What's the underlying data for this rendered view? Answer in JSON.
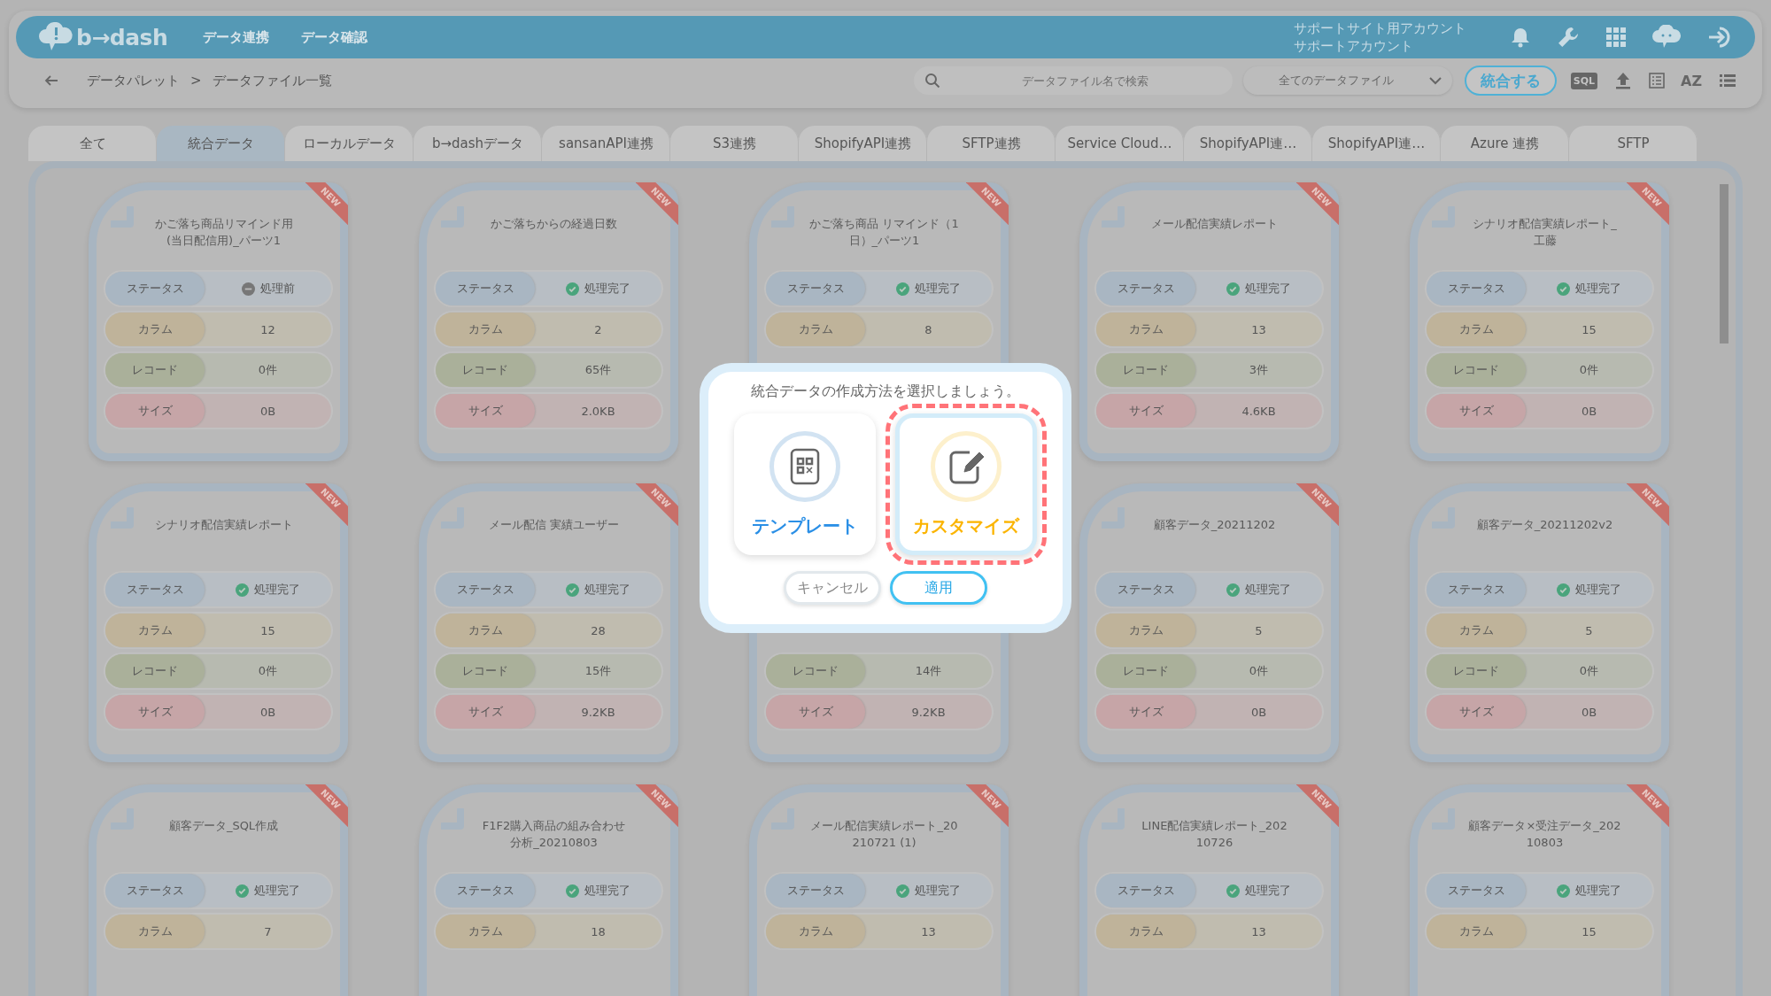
{
  "header": {
    "logo": "b→dash",
    "nav": [
      {
        "label": "データ連携"
      },
      {
        "label": "データ確認"
      }
    ],
    "account": [
      "サポートサイト用アカウント",
      "サポートアカウント"
    ]
  },
  "toolbar": {
    "breadcrumb": [
      "データパレット",
      "データファイル一覧"
    ],
    "separator": ">",
    "search": {
      "placeholder": "データファイル名で検索"
    },
    "filter": "全てのデータファイル",
    "merge_button": "統合する",
    "sql_label": "SQL",
    "sort_label": "AZ"
  },
  "tabs": [
    {
      "label": "全て",
      "selected": false
    },
    {
      "label": "統合データ",
      "selected": true
    },
    {
      "label": "ローカルデータ",
      "selected": false
    },
    {
      "label": "b→dashデータ",
      "selected": false
    },
    {
      "label": "sansanAPI連携",
      "selected": false
    },
    {
      "label": "S3連携",
      "selected": false
    },
    {
      "label": "ShopifyAPI連携",
      "selected": false
    },
    {
      "label": "SFTP連携",
      "selected": false
    },
    {
      "label": "Service Cloud…",
      "selected": false
    },
    {
      "label": "ShopifyAPI連…",
      "selected": false
    },
    {
      "label": "ShopifyAPI連…",
      "selected": false
    },
    {
      "label": "Azure 連携",
      "selected": false
    },
    {
      "label": "SFTP",
      "selected": false
    }
  ],
  "cards": [
    {
      "title": [
        "かご落ち商品リマインド用",
        "(当日配信用)_パーツ1"
      ],
      "badge": "NEW",
      "fields": [
        {
          "kind": "status",
          "label": "ステータス",
          "value": "処理前",
          "done": false
        },
        {
          "kind": "column",
          "label": "カラム",
          "value": "12"
        },
        {
          "kind": "record",
          "label": "レコード",
          "value": "0件"
        },
        {
          "kind": "size",
          "label": "サイズ",
          "value": "0B"
        }
      ]
    },
    {
      "title": [
        "かご落ちからの経過日数"
      ],
      "badge": "NEW",
      "fields": [
        {
          "kind": "status",
          "label": "ステータス",
          "value": "処理完了",
          "done": true
        },
        {
          "kind": "column",
          "label": "カラム",
          "value": "2"
        },
        {
          "kind": "record",
          "label": "レコード",
          "value": "65件"
        },
        {
          "kind": "size",
          "label": "サイズ",
          "value": "2.0KB"
        }
      ]
    },
    {
      "title": [
        "かご落ち商品 リマインド（1",
        "日）_パーツ1"
      ],
      "badge": "NEW",
      "fields": [
        {
          "kind": "status",
          "label": "ステータス",
          "value": "処理完了",
          "done": true
        },
        {
          "kind": "column",
          "label": "カラム",
          "value": "8"
        }
      ]
    },
    {
      "title": [
        "メール配信実績レポート"
      ],
      "badge": "NEW",
      "fields": [
        {
          "kind": "status",
          "label": "ステータス",
          "value": "処理完了",
          "done": true
        },
        {
          "kind": "column",
          "label": "カラム",
          "value": "13"
        },
        {
          "kind": "record",
          "label": "レコード",
          "value": "3件"
        },
        {
          "kind": "size",
          "label": "サイズ",
          "value": "4.6KB"
        }
      ]
    },
    {
      "title": [
        "シナリオ配信実績レポート_",
        "工藤"
      ],
      "badge": "NEW",
      "fields": [
        {
          "kind": "status",
          "label": "ステータス",
          "value": "処理完了",
          "done": true
        },
        {
          "kind": "column",
          "label": "カラム",
          "value": "15"
        },
        {
          "kind": "record",
          "label": "レコード",
          "value": "0件"
        },
        {
          "kind": "size",
          "label": "サイズ",
          "value": "0B"
        }
      ]
    },
    {
      "title": [
        "シナリオ配信実績レポート"
      ],
      "badge": "NEW",
      "fields": [
        {
          "kind": "status",
          "label": "ステータス",
          "value": "処理完了",
          "done": true
        },
        {
          "kind": "column",
          "label": "カラム",
          "value": "15"
        },
        {
          "kind": "record",
          "label": "レコード",
          "value": "0件"
        },
        {
          "kind": "size",
          "label": "サイズ",
          "value": "0B"
        }
      ]
    },
    {
      "title": [
        "メール配信 実績ユーザー"
      ],
      "badge": "NEW",
      "fields": [
        {
          "kind": "status",
          "label": "ステータス",
          "value": "処理完了",
          "done": true
        },
        {
          "kind": "column",
          "label": "カラム",
          "value": "28"
        },
        {
          "kind": "record",
          "label": "レコード",
          "value": "15件"
        },
        {
          "kind": "size",
          "label": "サイズ",
          "value": "9.2KB"
        }
      ]
    },
    {
      "fields": [
        {
          "kind": "record",
          "label": "レコード",
          "value": "14件"
        },
        {
          "kind": "size",
          "label": "サイズ",
          "value": "9.2KB"
        }
      ]
    },
    {
      "title": [
        "顧客データ_20211202"
      ],
      "badge": "NEW",
      "fields": [
        {
          "kind": "status",
          "label": "ステータス",
          "value": "処理完了",
          "done": true
        },
        {
          "kind": "column",
          "label": "カラム",
          "value": "5"
        },
        {
          "kind": "record",
          "label": "レコード",
          "value": "0件"
        },
        {
          "kind": "size",
          "label": "サイズ",
          "value": "0B"
        }
      ]
    },
    {
      "title": [
        "顧客データ_20211202v2"
      ],
      "badge": "NEW",
      "fields": [
        {
          "kind": "status",
          "label": "ステータス",
          "value": "処理完了",
          "done": true
        },
        {
          "kind": "column",
          "label": "カラム",
          "value": "5"
        },
        {
          "kind": "record",
          "label": "レコード",
          "value": "0件"
        },
        {
          "kind": "size",
          "label": "サイズ",
          "value": "0B"
        }
      ]
    },
    {
      "title": [
        "顧客データ_SQL作成"
      ],
      "badge": "NEW",
      "fields": [
        {
          "kind": "status",
          "label": "ステータス",
          "value": "処理完了",
          "done": true
        },
        {
          "kind": "column",
          "label": "カラム",
          "value": "7"
        }
      ]
    },
    {
      "title": [
        "F1F2購入商品の組み合わせ",
        "分析_20210803"
      ],
      "badge": "NEW",
      "fields": [
        {
          "kind": "status",
          "label": "ステータス",
          "value": "処理完了",
          "done": true
        },
        {
          "kind": "column",
          "label": "カラム",
          "value": "18"
        }
      ]
    },
    {
      "title": [
        "メール配信実績レポート_20",
        "210721 (1)"
      ],
      "badge": "NEW",
      "fields": [
        {
          "kind": "status",
          "label": "ステータス",
          "value": "処理完了",
          "done": true
        },
        {
          "kind": "column",
          "label": "カラム",
          "value": "13"
        }
      ]
    },
    {
      "title": [
        "LINE配信実績レポート_202",
        "10726"
      ],
      "badge": "NEW",
      "fields": [
        {
          "kind": "status",
          "label": "ステータス",
          "value": "処理完了",
          "done": true
        },
        {
          "kind": "column",
          "label": "カラム",
          "value": "13"
        }
      ]
    },
    {
      "title": [
        "顧客データ×受注データ_202",
        "10803"
      ],
      "badge": "NEW",
      "fields": [
        {
          "kind": "status",
          "label": "ステータス",
          "value": "処理完了",
          "done": true
        },
        {
          "kind": "column",
          "label": "カラム",
          "value": "15"
        }
      ]
    }
  ],
  "dialog": {
    "title": "統合データの作成方法を選択しましょう。",
    "options": [
      {
        "kind": "template",
        "label": "テンプレート",
        "selected": false
      },
      {
        "kind": "custom",
        "label": "カスタマイズ",
        "selected": true
      }
    ],
    "cancel": "キャンセル",
    "apply": "適用"
  }
}
